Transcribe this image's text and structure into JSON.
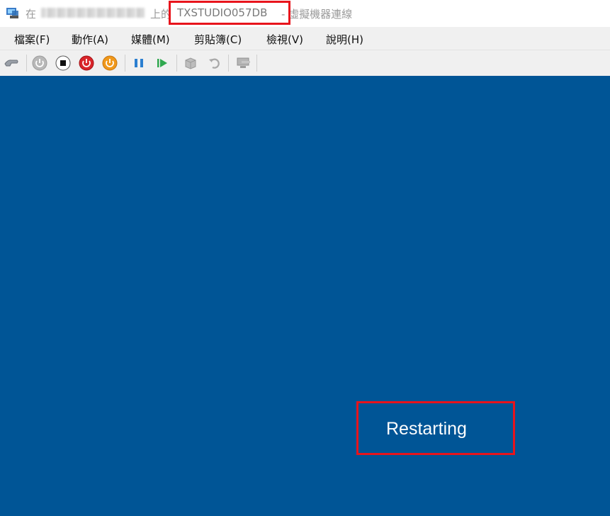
{
  "window": {
    "icon": "hyperv-vm-connection-icon",
    "title_prefix": "在",
    "title_mid": "上的",
    "vm_name": "TXSTUDIO057DB",
    "title_suffix": "- 虛擬機器連線"
  },
  "menu": [
    "檔案(F)",
    "動作(A)",
    "媒體(M)",
    "剪貼簿(C)",
    "檢視(V)",
    "說明(H)"
  ],
  "toolbar": {
    "buttons": [
      "ctrl-alt-del-icon",
      "start-icon",
      "turn-off-icon",
      "shut-down-icon",
      "save-icon",
      "pause-icon",
      "reset-icon",
      "checkpoint-icon",
      "revert-icon",
      "enhanced-session-icon"
    ]
  },
  "screen": {
    "status": "Restarting",
    "background": "#005596"
  },
  "highlight_color": "#e8141c"
}
